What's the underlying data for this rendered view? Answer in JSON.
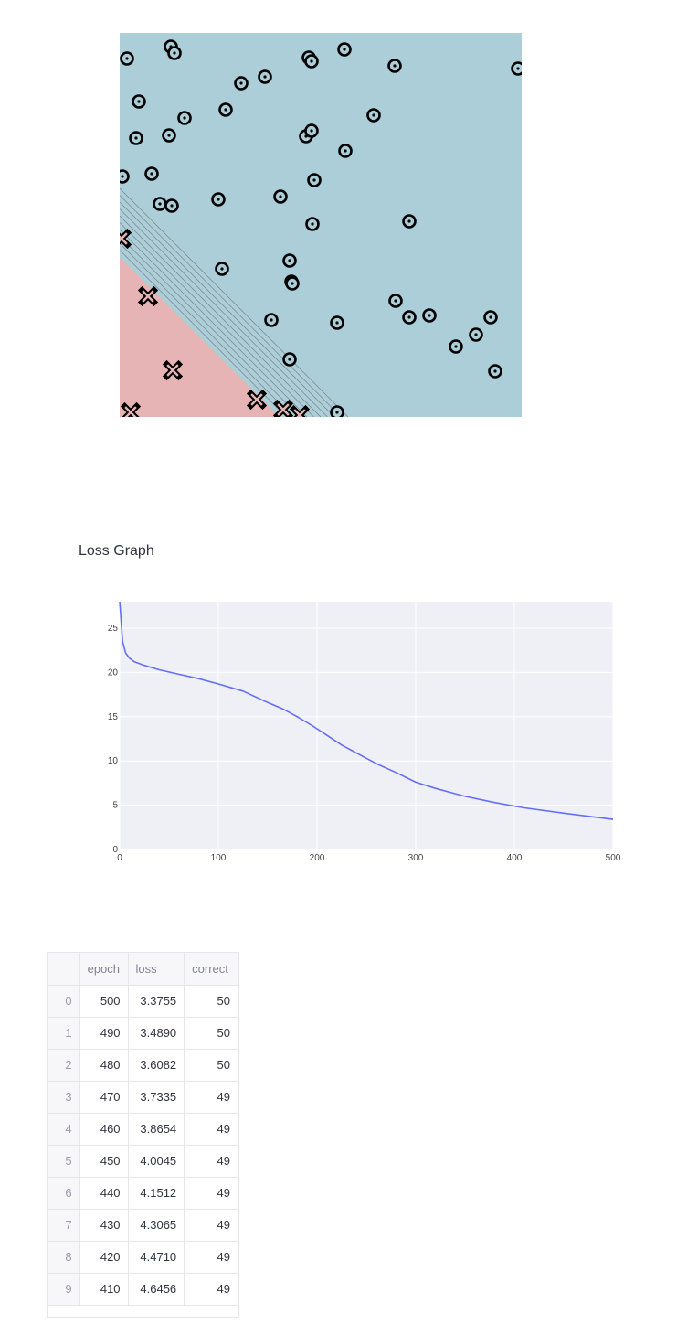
{
  "colors": {
    "class_a_region": "#acced9",
    "class_b_region": "#e6b4b4",
    "contour_line": "#6b6b6b",
    "marker_stroke": "#000000",
    "loss_line": "#636efa",
    "plot_bg": "#eff0f5",
    "grid": "#ffffff"
  },
  "decision_boundary": {
    "marker_legend": {
      "circle_marker": "circle-dot-icon",
      "cross_marker": "x-cross-icon"
    }
  },
  "loss_section": {
    "title": "Loss Graph"
  },
  "chart_data": {
    "type": "line",
    "title": "",
    "xlabel": "",
    "ylabel": "",
    "xlim": [
      0,
      500
    ],
    "ylim": [
      0,
      28
    ],
    "xticks": [
      "0",
      "100",
      "200",
      "300",
      "400",
      "500"
    ],
    "yticks": [
      "0",
      "5",
      "10",
      "15",
      "20",
      "25"
    ],
    "grid": true,
    "series": [
      {
        "x": [
          0,
          3,
          6,
          10,
          15,
          25,
          40,
          60,
          80,
          100,
          125,
          150,
          165,
          180,
          195,
          210,
          225,
          250,
          262,
          280,
          300,
          320,
          350,
          380,
          410,
          450,
          500
        ],
        "values": [
          28,
          23.5,
          22.2,
          21.6,
          21.2,
          20.8,
          20.3,
          19.8,
          19.3,
          18.7,
          17.9,
          16.6,
          15.9,
          15.0,
          14.0,
          12.9,
          11.8,
          10.3,
          9.6,
          8.7,
          7.6,
          6.9,
          6.0,
          5.3,
          4.7,
          4.1,
          3.4
        ]
      }
    ]
  },
  "table": {
    "columns": [
      "",
      "epoch",
      "loss",
      "correct"
    ],
    "rows": [
      [
        "0",
        "500",
        "3.3755",
        "50"
      ],
      [
        "1",
        "490",
        "3.4890",
        "50"
      ],
      [
        "2",
        "480",
        "3.6082",
        "50"
      ],
      [
        "3",
        "470",
        "3.7335",
        "49"
      ],
      [
        "4",
        "460",
        "3.8654",
        "49"
      ],
      [
        "5",
        "450",
        "4.0045",
        "49"
      ],
      [
        "6",
        "440",
        "4.1512",
        "49"
      ],
      [
        "7",
        "430",
        "4.3065",
        "49"
      ],
      [
        "8",
        "420",
        "4.4710",
        "49"
      ],
      [
        "9",
        "410",
        "4.6456",
        "49"
      ]
    ]
  }
}
